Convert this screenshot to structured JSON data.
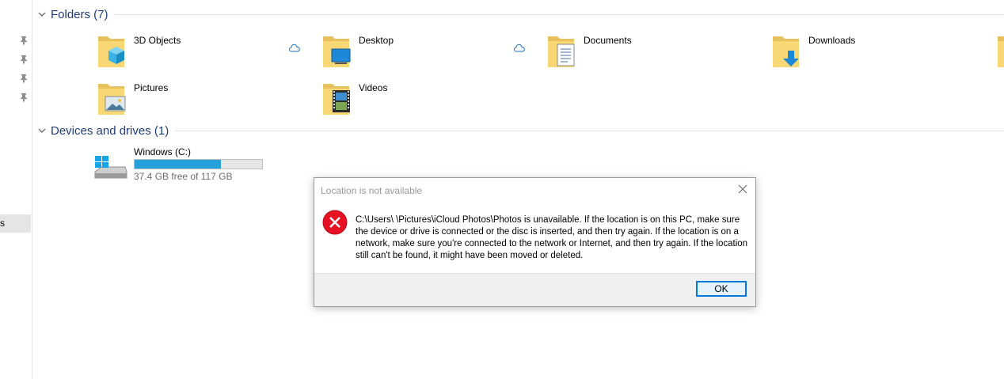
{
  "sections": {
    "folders_title": "Folders (7)",
    "devices_title": "Devices and drives (1)"
  },
  "folders": [
    {
      "label": "3D Objects",
      "icon": "3d-objects-folder-icon"
    },
    {
      "label": "Desktop",
      "icon": "desktop-folder-icon"
    },
    {
      "label": "Documents",
      "icon": "documents-folder-icon"
    },
    {
      "label": "Downloads",
      "icon": "downloads-folder-icon"
    },
    {
      "label": "Pictures",
      "icon": "pictures-folder-icon"
    },
    {
      "label": "Videos",
      "icon": "videos-folder-icon"
    }
  ],
  "nav": {
    "selected_label": "s"
  },
  "drive": {
    "label": "Windows (C:)",
    "free_text": "37.4 GB free of 117 GB",
    "used_fraction": 0.68,
    "bar_color": "#26a0da"
  },
  "dialog": {
    "title": "Location is not available",
    "message": "C:\\Users\\           \\Pictures\\iCloud Photos\\Photos is unavailable. If the location is on this PC, make sure the device or drive is connected or the disc is inserted, and then try again. If the location is on a network, make sure you're connected to the network or Internet, and then try again. If the location still can't be found, it might have been moved or deleted.",
    "ok_label": "OK",
    "error_color": "#e81123"
  }
}
